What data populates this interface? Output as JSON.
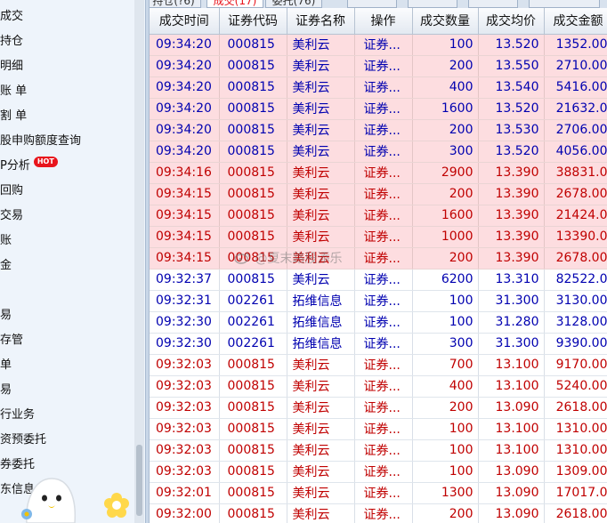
{
  "sidebar": {
    "items": [
      {
        "label": "成交"
      },
      {
        "label": "持仓"
      },
      {
        "label": "明细"
      },
      {
        "label": "账 单"
      },
      {
        "label": "割 单"
      },
      {
        "label": "股申购额度查询"
      },
      {
        "label": "P分析",
        "badge": "HOT"
      },
      {
        "label": "回购"
      },
      {
        "label": "交易"
      },
      {
        "label": "账"
      },
      {
        "label": "金"
      },
      {
        "label": "易"
      },
      {
        "label": "存管"
      },
      {
        "label": "单"
      },
      {
        "label": "易"
      },
      {
        "label": "行业务"
      },
      {
        "label": "资预委托"
      },
      {
        "label": "券委托"
      },
      {
        "label": "东信息"
      }
    ]
  },
  "tabs": [
    {
      "label": "持仓(?6)"
    },
    {
      "label": "成交(17)",
      "active": true
    },
    {
      "label": "委托(76)"
    },
    {
      "label": ""
    },
    {
      "label": ""
    },
    {
      "label": ""
    },
    {
      "label": ""
    }
  ],
  "grid": {
    "headers": [
      "成交时间",
      "证券代码",
      "证券名称",
      "操作",
      "成交数量",
      "成交均价",
      "成交金额"
    ],
    "rows": [
      {
        "bg": "pink",
        "color": "blue",
        "cells": [
          "09:34:20",
          "000815",
          "美利云",
          "证券...",
          "100",
          "13.520",
          "1352.00"
        ]
      },
      {
        "bg": "pink",
        "color": "blue",
        "cells": [
          "09:34:20",
          "000815",
          "美利云",
          "证券...",
          "200",
          "13.550",
          "2710.00"
        ]
      },
      {
        "bg": "pink",
        "color": "blue",
        "cells": [
          "09:34:20",
          "000815",
          "美利云",
          "证券...",
          "400",
          "13.540",
          "5416.00"
        ]
      },
      {
        "bg": "pink",
        "color": "blue",
        "cells": [
          "09:34:20",
          "000815",
          "美利云",
          "证券...",
          "1600",
          "13.520",
          "21632.0"
        ]
      },
      {
        "bg": "pink",
        "color": "blue",
        "cells": [
          "09:34:20",
          "000815",
          "美利云",
          "证券...",
          "200",
          "13.530",
          "2706.00"
        ]
      },
      {
        "bg": "pink",
        "color": "blue",
        "cells": [
          "09:34:20",
          "000815",
          "美利云",
          "证券...",
          "300",
          "13.520",
          "4056.00"
        ]
      },
      {
        "bg": "pink",
        "color": "red",
        "cells": [
          "09:34:16",
          "000815",
          "美利云",
          "证券...",
          "2900",
          "13.390",
          "38831.0"
        ]
      },
      {
        "bg": "pink",
        "color": "red",
        "cells": [
          "09:34:15",
          "000815",
          "美利云",
          "证券...",
          "200",
          "13.390",
          "2678.00"
        ]
      },
      {
        "bg": "pink",
        "color": "red",
        "cells": [
          "09:34:15",
          "000815",
          "美利云",
          "证券...",
          "1600",
          "13.390",
          "21424.0"
        ]
      },
      {
        "bg": "pink",
        "color": "red",
        "cells": [
          "09:34:15",
          "000815",
          "美利云",
          "证券...",
          "1000",
          "13.390",
          "13390.0"
        ]
      },
      {
        "bg": "pink",
        "color": "red",
        "cells": [
          "09:34:15",
          "000815",
          "美利云",
          "证券...",
          "200",
          "13.390",
          "2678.00"
        ]
      },
      {
        "bg": "white",
        "color": "blue",
        "cells": [
          "09:32:37",
          "000815",
          "美利云",
          "证券...",
          "6200",
          "13.310",
          "82522.0"
        ]
      },
      {
        "bg": "white",
        "color": "blue",
        "cells": [
          "09:32:31",
          "002261",
          "拓维信息",
          "证券...",
          "100",
          "31.300",
          "3130.00"
        ]
      },
      {
        "bg": "white",
        "color": "blue",
        "cells": [
          "09:32:30",
          "002261",
          "拓维信息",
          "证券...",
          "100",
          "31.280",
          "3128.00"
        ]
      },
      {
        "bg": "white",
        "color": "blue",
        "cells": [
          "09:32:30",
          "002261",
          "拓维信息",
          "证券...",
          "300",
          "31.300",
          "9390.00"
        ]
      },
      {
        "bg": "white",
        "color": "red",
        "cells": [
          "09:32:03",
          "000815",
          "美利云",
          "证券...",
          "700",
          "13.100",
          "9170.00"
        ]
      },
      {
        "bg": "white",
        "color": "red",
        "cells": [
          "09:32:03",
          "000815",
          "美利云",
          "证券...",
          "400",
          "13.100",
          "5240.00"
        ]
      },
      {
        "bg": "white",
        "color": "red",
        "cells": [
          "09:32:03",
          "000815",
          "美利云",
          "证券...",
          "200",
          "13.090",
          "2618.00"
        ]
      },
      {
        "bg": "white",
        "color": "red",
        "cells": [
          "09:32:03",
          "000815",
          "美利云",
          "证券...",
          "100",
          "13.100",
          "1310.00"
        ]
      },
      {
        "bg": "white",
        "color": "red",
        "cells": [
          "09:32:03",
          "000815",
          "美利云",
          "证券...",
          "100",
          "13.100",
          "1310.00"
        ]
      },
      {
        "bg": "white",
        "color": "red",
        "cells": [
          "09:32:03",
          "000815",
          "美利云",
          "证券...",
          "100",
          "13.090",
          "1309.00"
        ]
      },
      {
        "bg": "white",
        "color": "red",
        "cells": [
          "09:32:01",
          "000815",
          "美利云",
          "证券...",
          "1300",
          "13.090",
          "17017.0"
        ]
      },
      {
        "bg": "white",
        "color": "red",
        "cells": [
          "09:32:00",
          "000815",
          "美利云",
          "证券...",
          "200",
          "13.090",
          "2618.00"
        ]
      }
    ]
  },
  "watermark": {
    "text": "@夏末路股添乐",
    "icon": "weibo-icon"
  },
  "stickers": {
    "ghost": "ghost-sticker",
    "flower": "flower-sticker"
  },
  "colors": {
    "sell_text": "#0000b0",
    "buy_text": "#c00000",
    "highlight_row": "#fddde0",
    "hot_badge": "#e8141c",
    "sidebar_bg": "#eef4fb"
  }
}
